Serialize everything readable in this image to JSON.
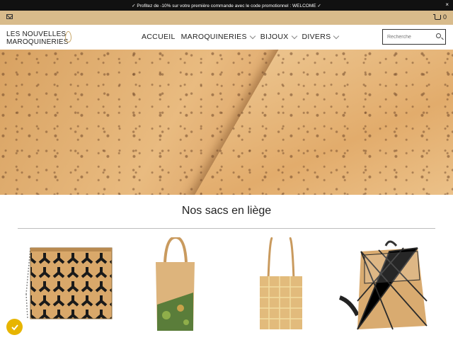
{
  "announcement": {
    "text": "✓ Profitez de -10% sur votre première commande avec le code promotionnel : WELCOME ✓",
    "close": "×"
  },
  "topbar": {
    "cart_count": "0"
  },
  "logo": {
    "line1": "LES NOUVELLES",
    "line2": "MAROQUINERIES"
  },
  "nav": {
    "items": [
      {
        "label": "ACCUEIL",
        "dropdown": false
      },
      {
        "label": "MAROQUINERIES",
        "dropdown": true
      },
      {
        "label": "BIJOUX",
        "dropdown": true
      },
      {
        "label": "DIVERS",
        "dropdown": true
      }
    ]
  },
  "search": {
    "placeholder": "Recherche"
  },
  "section": {
    "title": "Nos sacs en liège"
  },
  "badge": {
    "icon": "check-icon"
  }
}
